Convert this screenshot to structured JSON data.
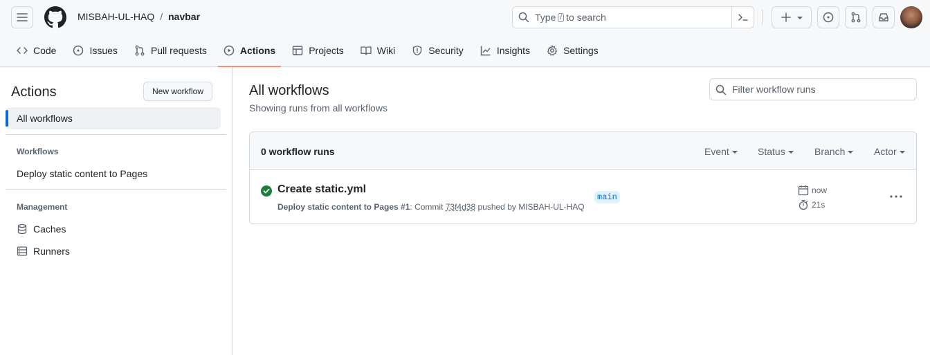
{
  "header": {
    "owner": "MISBAH-UL-HAQ",
    "separator": "/",
    "repo": "navbar",
    "search": {
      "prefix": "Type",
      "key": "/",
      "suffix": "to search"
    },
    "icons": [
      "hamburger-icon",
      "github-logo",
      "search-icon",
      "command-palette-icon",
      "plus-icon",
      "issues-icon",
      "pull-requests-icon",
      "inbox-icon"
    ]
  },
  "repo_nav": {
    "tabs": [
      {
        "label": "Code",
        "icon": "code-icon"
      },
      {
        "label": "Issues",
        "icon": "issue-icon"
      },
      {
        "label": "Pull requests",
        "icon": "pull-request-icon"
      },
      {
        "label": "Actions",
        "icon": "play-icon",
        "active": true
      },
      {
        "label": "Projects",
        "icon": "table-icon"
      },
      {
        "label": "Wiki",
        "icon": "book-icon"
      },
      {
        "label": "Security",
        "icon": "shield-icon"
      },
      {
        "label": "Insights",
        "icon": "graph-icon"
      },
      {
        "label": "Settings",
        "icon": "gear-icon"
      }
    ]
  },
  "sidebar": {
    "title": "Actions",
    "new_workflow": "New workflow",
    "all_workflows": "All workflows",
    "workflows_heading": "Workflows",
    "workflows": [
      "Deploy static content to Pages"
    ],
    "management_heading": "Management",
    "management": [
      {
        "label": "Caches",
        "icon": "database-icon"
      },
      {
        "label": "Runners",
        "icon": "server-icon"
      }
    ]
  },
  "main": {
    "title": "All workflows",
    "subtitle": "Showing runs from all workflows",
    "filter_placeholder": "Filter workflow runs",
    "runs_count": "0 workflow runs",
    "filters": [
      "Event",
      "Status",
      "Branch",
      "Actor"
    ],
    "runs": [
      {
        "title": "Create static.yml",
        "workflow": "Deploy static content to Pages",
        "run_number": "#1",
        "commit_prefix": ": Commit",
        "commit": "73f4d38",
        "pushed_by": "pushed by MISBAH-UL-HAQ",
        "branch": "main",
        "when": "now",
        "duration": "21s",
        "status": "success"
      }
    ]
  },
  "colors": {
    "accent": "#0969da",
    "active_tab_underline": "#fd8c73",
    "success": "#1a7f37",
    "header_bg": "#f6f8fa",
    "border": "#d1d9e0"
  }
}
